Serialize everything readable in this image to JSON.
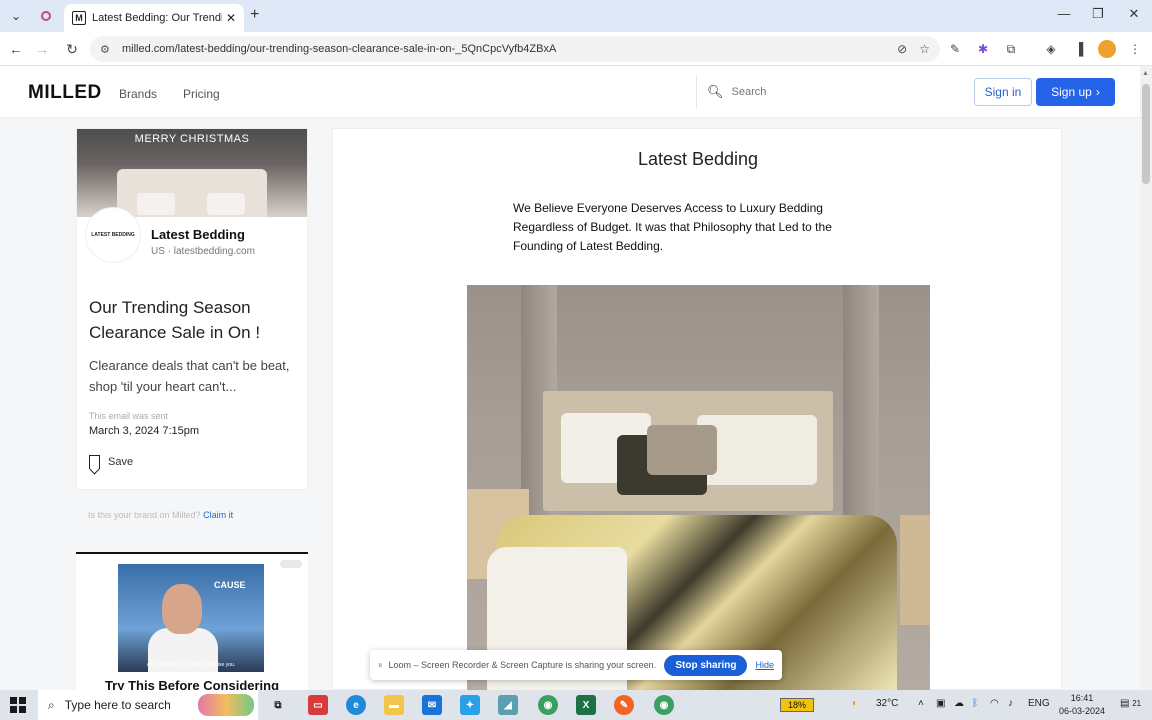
{
  "browser": {
    "active_tab_title": "Latest Bedding: Our Trending S",
    "active_tab_favicon": "M",
    "url": "milled.com/latest-bedding/our-trending-season-clearance-sale-in-on-_5QnCpcVyfb4ZBxA"
  },
  "site": {
    "logo": "MILLED",
    "nav": {
      "brands": "Brands",
      "pricing": "Pricing"
    },
    "search_placeholder": "Search",
    "sign_in": "Sign in",
    "sign_up": "Sign up"
  },
  "sidebar": {
    "hero_text": "MERRY CHRISTMAS",
    "brand_avatar_text": "LATEST BEDDING",
    "brand_name": "Latest Bedding",
    "brand_meta": "US · latestbedding.com",
    "email_title": "Our Trending Season Clearance Sale in On !",
    "email_desc": "Clearance deals that can't be beat, shop 'til your heart can't...",
    "sent_label": "This email was sent",
    "sent_date": "March 3, 2024 7:15pm",
    "save_label": "Save",
    "claim_text": "Is this your brand on Milled?",
    "claim_link": "Claim it"
  },
  "ad": {
    "cause_text": "CAUSE",
    "caption": "and I promise it is going to surprise you.",
    "headline": "Try This Before Considering"
  },
  "email": {
    "brand_heading": "Latest Bedding",
    "intro": "We Believe Everyone Deserves Access to Luxury Bedding Regardless of Budget. It was that Philosophy that Led to the Founding of Latest Bedding."
  },
  "loom": {
    "message": "Loom – Screen Recorder & Screen Capture is sharing your screen.",
    "stop": "Stop sharing",
    "hide": "Hide"
  },
  "taskbar": {
    "search_placeholder": "Type here to search",
    "battery": "18%",
    "weather": "32°C",
    "language": "ENG",
    "time": "16:41",
    "date": "06-03-2024",
    "notification_count": "21"
  },
  "colors": {
    "accent": "#2563e9",
    "tabstrip": "#dfe8f7",
    "content_bg": "#f5f6f8"
  }
}
